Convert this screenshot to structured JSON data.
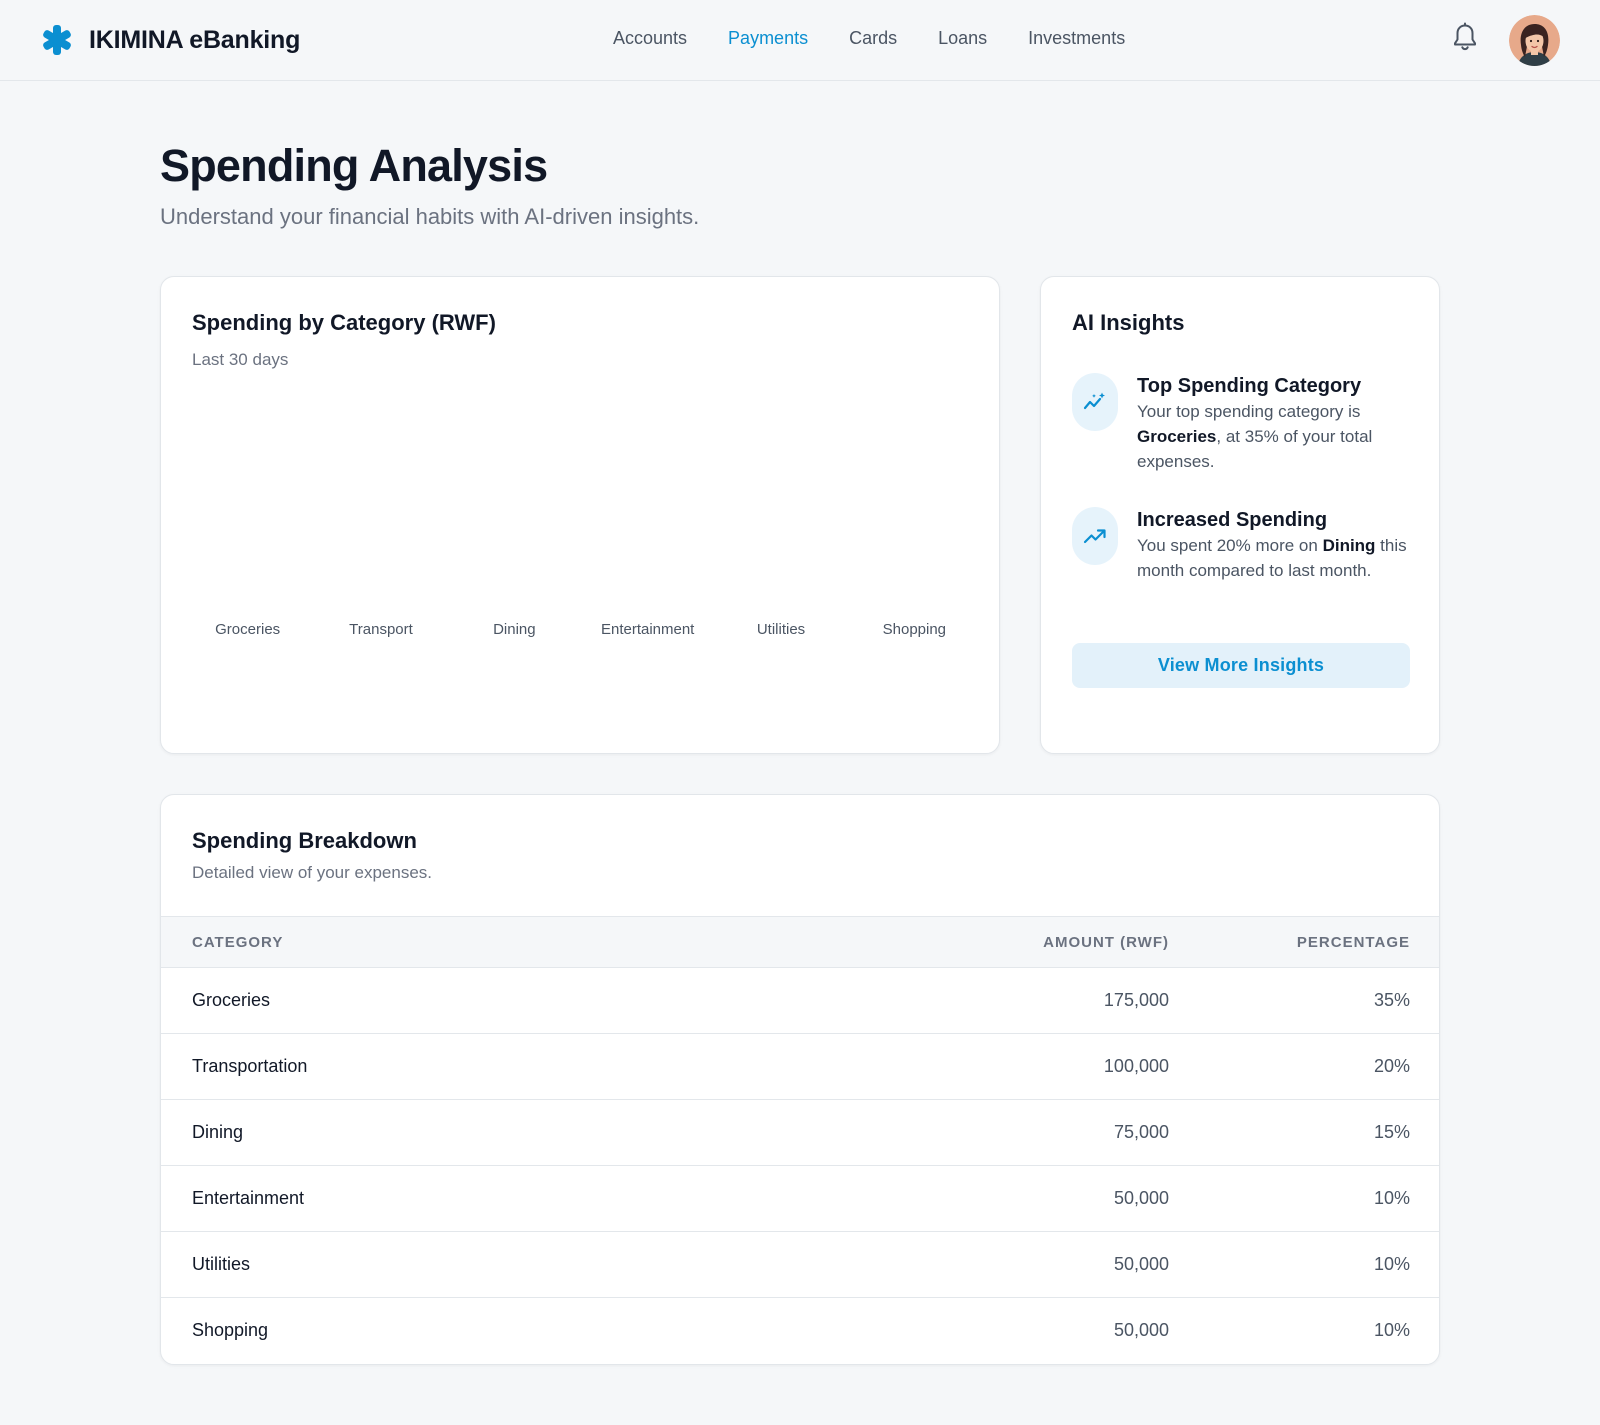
{
  "app": {
    "brand_name": "IKIMINA eBanking",
    "brand_icon": "asterisk-logo-icon",
    "accent_color": "#0b8fd1"
  },
  "nav": {
    "items": [
      {
        "label": "Accounts",
        "active": false
      },
      {
        "label": "Payments",
        "active": true
      },
      {
        "label": "Cards",
        "active": false
      },
      {
        "label": "Loans",
        "active": false
      },
      {
        "label": "Investments",
        "active": false
      }
    ],
    "notification_icon": "bell-icon",
    "avatar_icon": "user-avatar"
  },
  "page": {
    "title": "Spending Analysis",
    "subtitle": "Understand your financial habits with AI-driven insights."
  },
  "chart_card": {
    "title": "Spending by Category (RWF)",
    "subtitle": "Last 30 days"
  },
  "chart_data": {
    "type": "bar",
    "title": "Spending by Category (RWF)",
    "subtitle": "Last 30 days",
    "categories": [
      "Groceries",
      "Transport",
      "Dining",
      "Entertainment",
      "Utilities",
      "Shopping"
    ],
    "values": [],
    "xlabel": "",
    "ylabel": "",
    "grid": false
  },
  "insights": {
    "title": "AI Insights",
    "items": [
      {
        "icon": "sparkle-chart-icon",
        "heading": "Top Spending Category",
        "text_before": "Your top spending category is ",
        "bold": "Groceries",
        "text_after": ", at 35% of your total expenses."
      },
      {
        "icon": "trending-up-icon",
        "heading": "Increased Spending",
        "text_before": "You spent 20% more on ",
        "bold": "Dining",
        "text_after": " this month compared to last month."
      }
    ],
    "button_label": "View More Insights"
  },
  "breakdown": {
    "title": "Spending Breakdown",
    "subtitle": "Detailed view of your expenses.",
    "columns": [
      "CATEGORY",
      "AMOUNT (RWF)",
      "PERCENTAGE"
    ],
    "rows": [
      {
        "category": "Groceries",
        "amount": "175,000",
        "percentage": "35%"
      },
      {
        "category": "Transportation",
        "amount": "100,000",
        "percentage": "20%"
      },
      {
        "category": "Dining",
        "amount": "75,000",
        "percentage": "15%"
      },
      {
        "category": "Entertainment",
        "amount": "50,000",
        "percentage": "10%"
      },
      {
        "category": "Utilities",
        "amount": "50,000",
        "percentage": "10%"
      },
      {
        "category": "Shopping",
        "amount": "50,000",
        "percentage": "10%"
      }
    ]
  }
}
